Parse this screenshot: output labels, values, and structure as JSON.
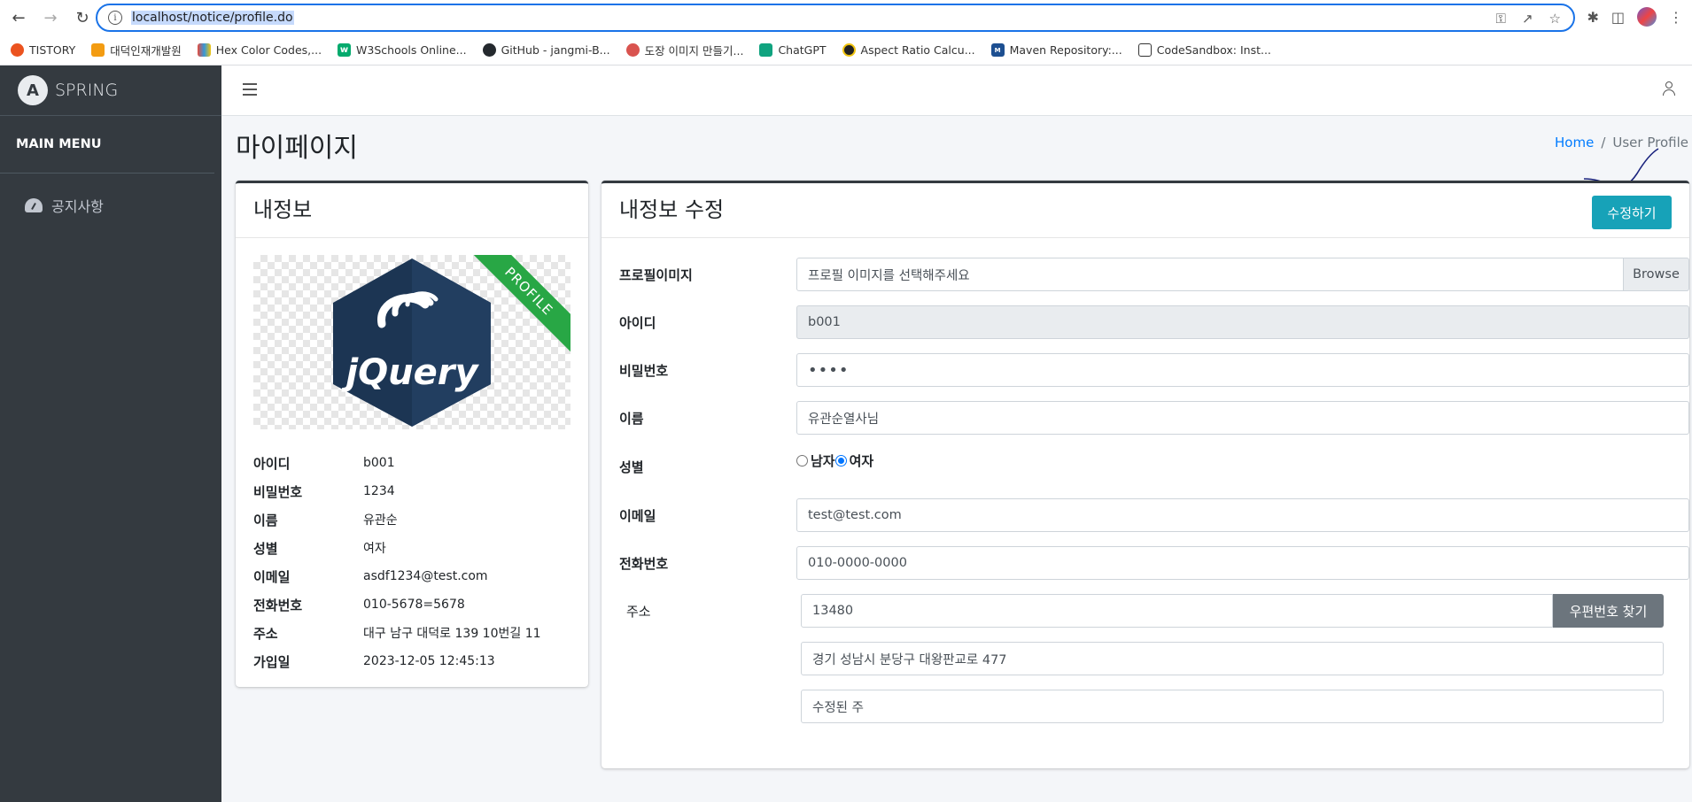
{
  "browser": {
    "url": "localhost/notice/profile.do",
    "bookmarks": [
      {
        "label": "TISTORY",
        "color": "#eb531f",
        "icon": "tistory-icon"
      },
      {
        "label": "대덕인재개발원",
        "color": "#f39c12",
        "icon": "ddit-icon"
      },
      {
        "label": "Hex Color Codes,...",
        "color": "#e74c3c",
        "icon": "hex-color-icon"
      },
      {
        "label": "W3Schools Online...",
        "color": "#04aa6d",
        "icon": "w3schools-icon"
      },
      {
        "label": "GitHub - jangmi-B...",
        "color": "#24292e",
        "icon": "github-icon"
      },
      {
        "label": "도장 이미지 만들기...",
        "color": "#d9534f",
        "icon": "stamp-icon"
      },
      {
        "label": "ChatGPT",
        "color": "#10a37f",
        "icon": "chatgpt-icon"
      },
      {
        "label": "Aspect Ratio Calcu...",
        "color": "#222222",
        "icon": "aspect-ratio-icon"
      },
      {
        "label": "Maven Repository:...",
        "color": "#1d4f91",
        "icon": "maven-icon"
      },
      {
        "label": "CodeSandbox: Inst...",
        "color": "#ffffff",
        "icon": "codesandbox-icon"
      }
    ]
  },
  "sidebar": {
    "brand": "SPRING",
    "menu_header": "MAIN MENU",
    "items": [
      {
        "label": "공지사항",
        "icon": "dashboard-gauge-icon"
      }
    ]
  },
  "page": {
    "title": "마이페이지",
    "breadcrumb": {
      "home": "Home",
      "current": "User Profile"
    }
  },
  "profile_card": {
    "title": "내정보",
    "ribbon": "PROFILE",
    "image_alt": "jQuery",
    "rows": [
      {
        "label": "아이디",
        "value": "b001"
      },
      {
        "label": "비밀번호",
        "value": "1234"
      },
      {
        "label": "이름",
        "value": "유관순"
      },
      {
        "label": "성별",
        "value": "여자"
      },
      {
        "label": "이메일",
        "value": "asdf1234@test.com"
      },
      {
        "label": "전화번호",
        "value": "010-5678=5678"
      },
      {
        "label": "주소",
        "value": "대구 남구 대덕로 139 10번길 11"
      },
      {
        "label": "가입일",
        "value": "2023-12-05 12:45:13"
      }
    ]
  },
  "edit_card": {
    "title": "내정보 수정",
    "submit_label": "수정하기",
    "profile_image": {
      "label": "프로필이미지",
      "placeholder": "프로필 이미지를 선택해주세요",
      "browse": "Browse"
    },
    "user_id": {
      "label": "아이디",
      "value": "b001"
    },
    "password": {
      "label": "비밀번호",
      "value": "••••"
    },
    "name": {
      "label": "이름",
      "value": "유관순열사님"
    },
    "gender": {
      "label": "성별",
      "options": [
        "남자",
        "여자"
      ],
      "selected": "여자"
    },
    "email": {
      "label": "이메일",
      "value": "test@test.com"
    },
    "phone": {
      "label": "전화번호",
      "value": "010-0000-0000"
    },
    "address": {
      "label": "주소",
      "zip": "13480",
      "zip_button": "우편번호 찾기",
      "addr1": "경기 성남시 분당구 대왕판교로 477",
      "addr2": "수정된 주"
    }
  },
  "colors": {
    "sidebar": "#343a40",
    "accent": "#17a2b8",
    "ribbon": "#28a745",
    "link": "#007bff"
  }
}
